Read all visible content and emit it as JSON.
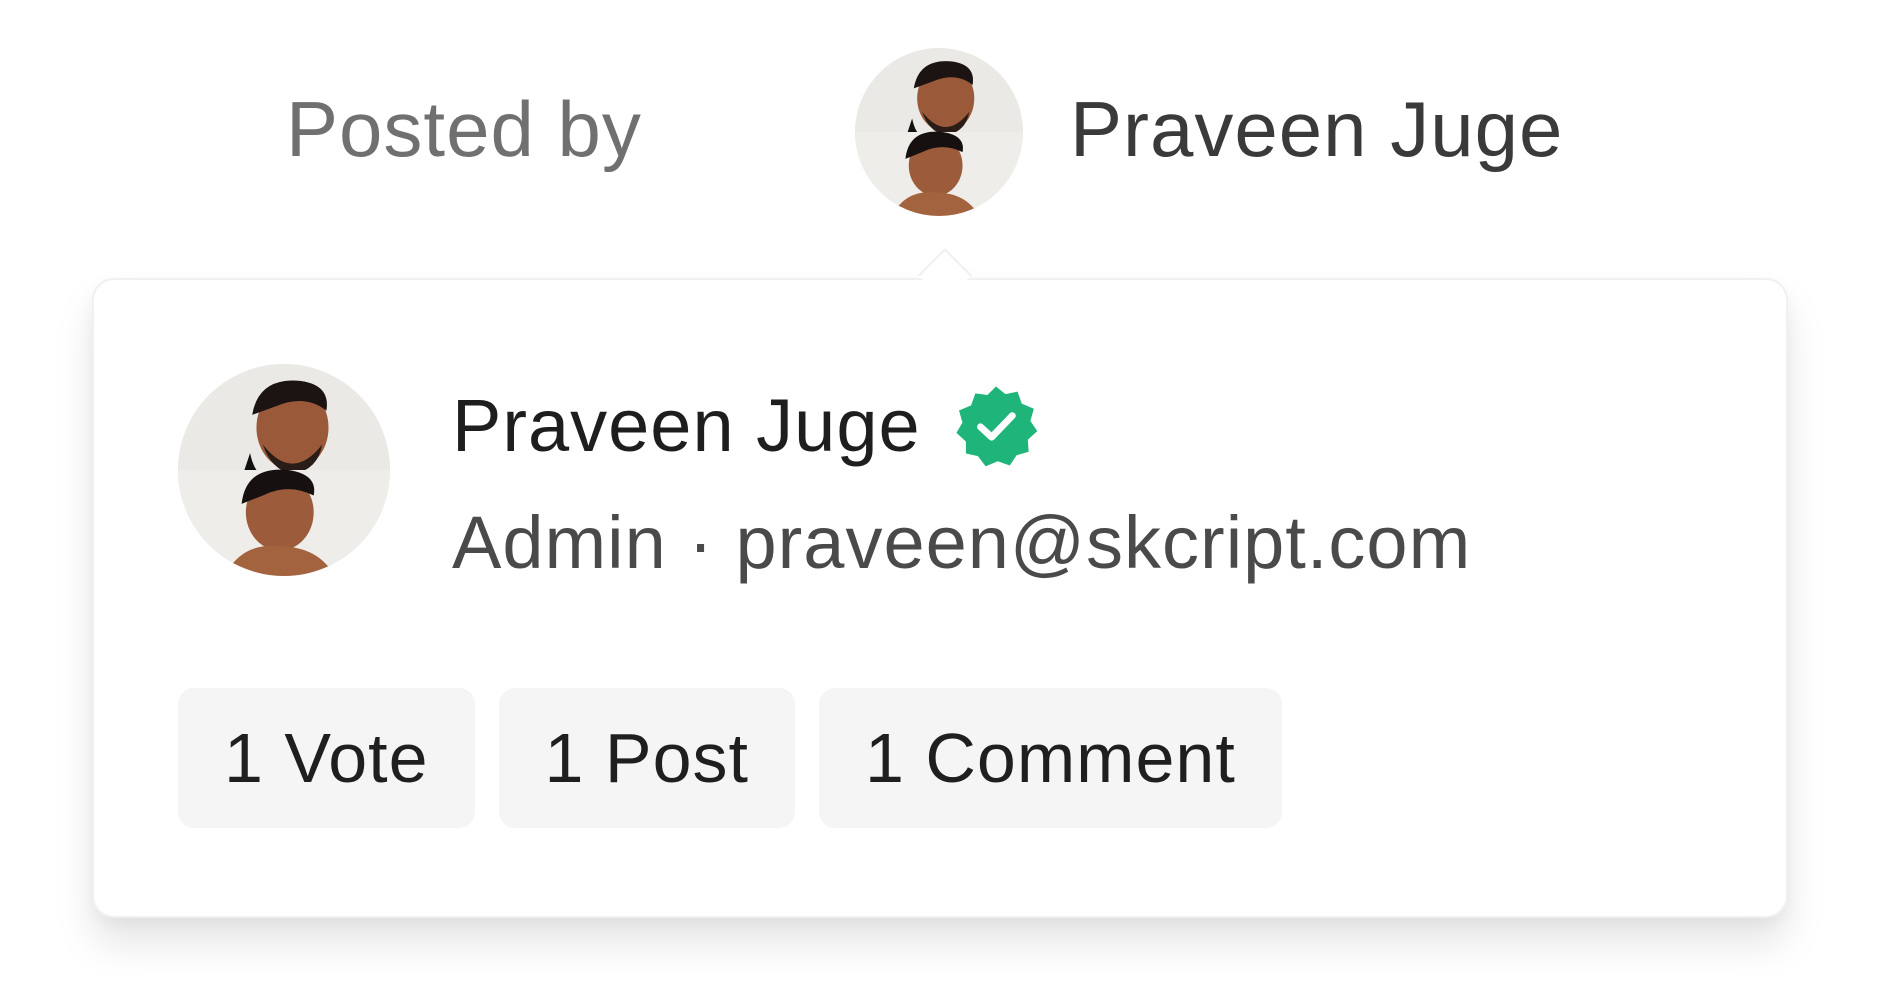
{
  "post_meta": {
    "posted_by_label": "Posted by",
    "author_name": "Praveen Juge",
    "author_avatar_icon": "user-avatar-photo"
  },
  "profile_card": {
    "name": "Praveen Juge",
    "verified_icon": "verified-badge-icon",
    "verified_color": "#1fb57a",
    "subtitle": "Admin · praveen@skcript.com",
    "stats": [
      {
        "label": "1 Vote"
      },
      {
        "label": "1 Post"
      },
      {
        "label": "1 Comment"
      }
    ]
  }
}
